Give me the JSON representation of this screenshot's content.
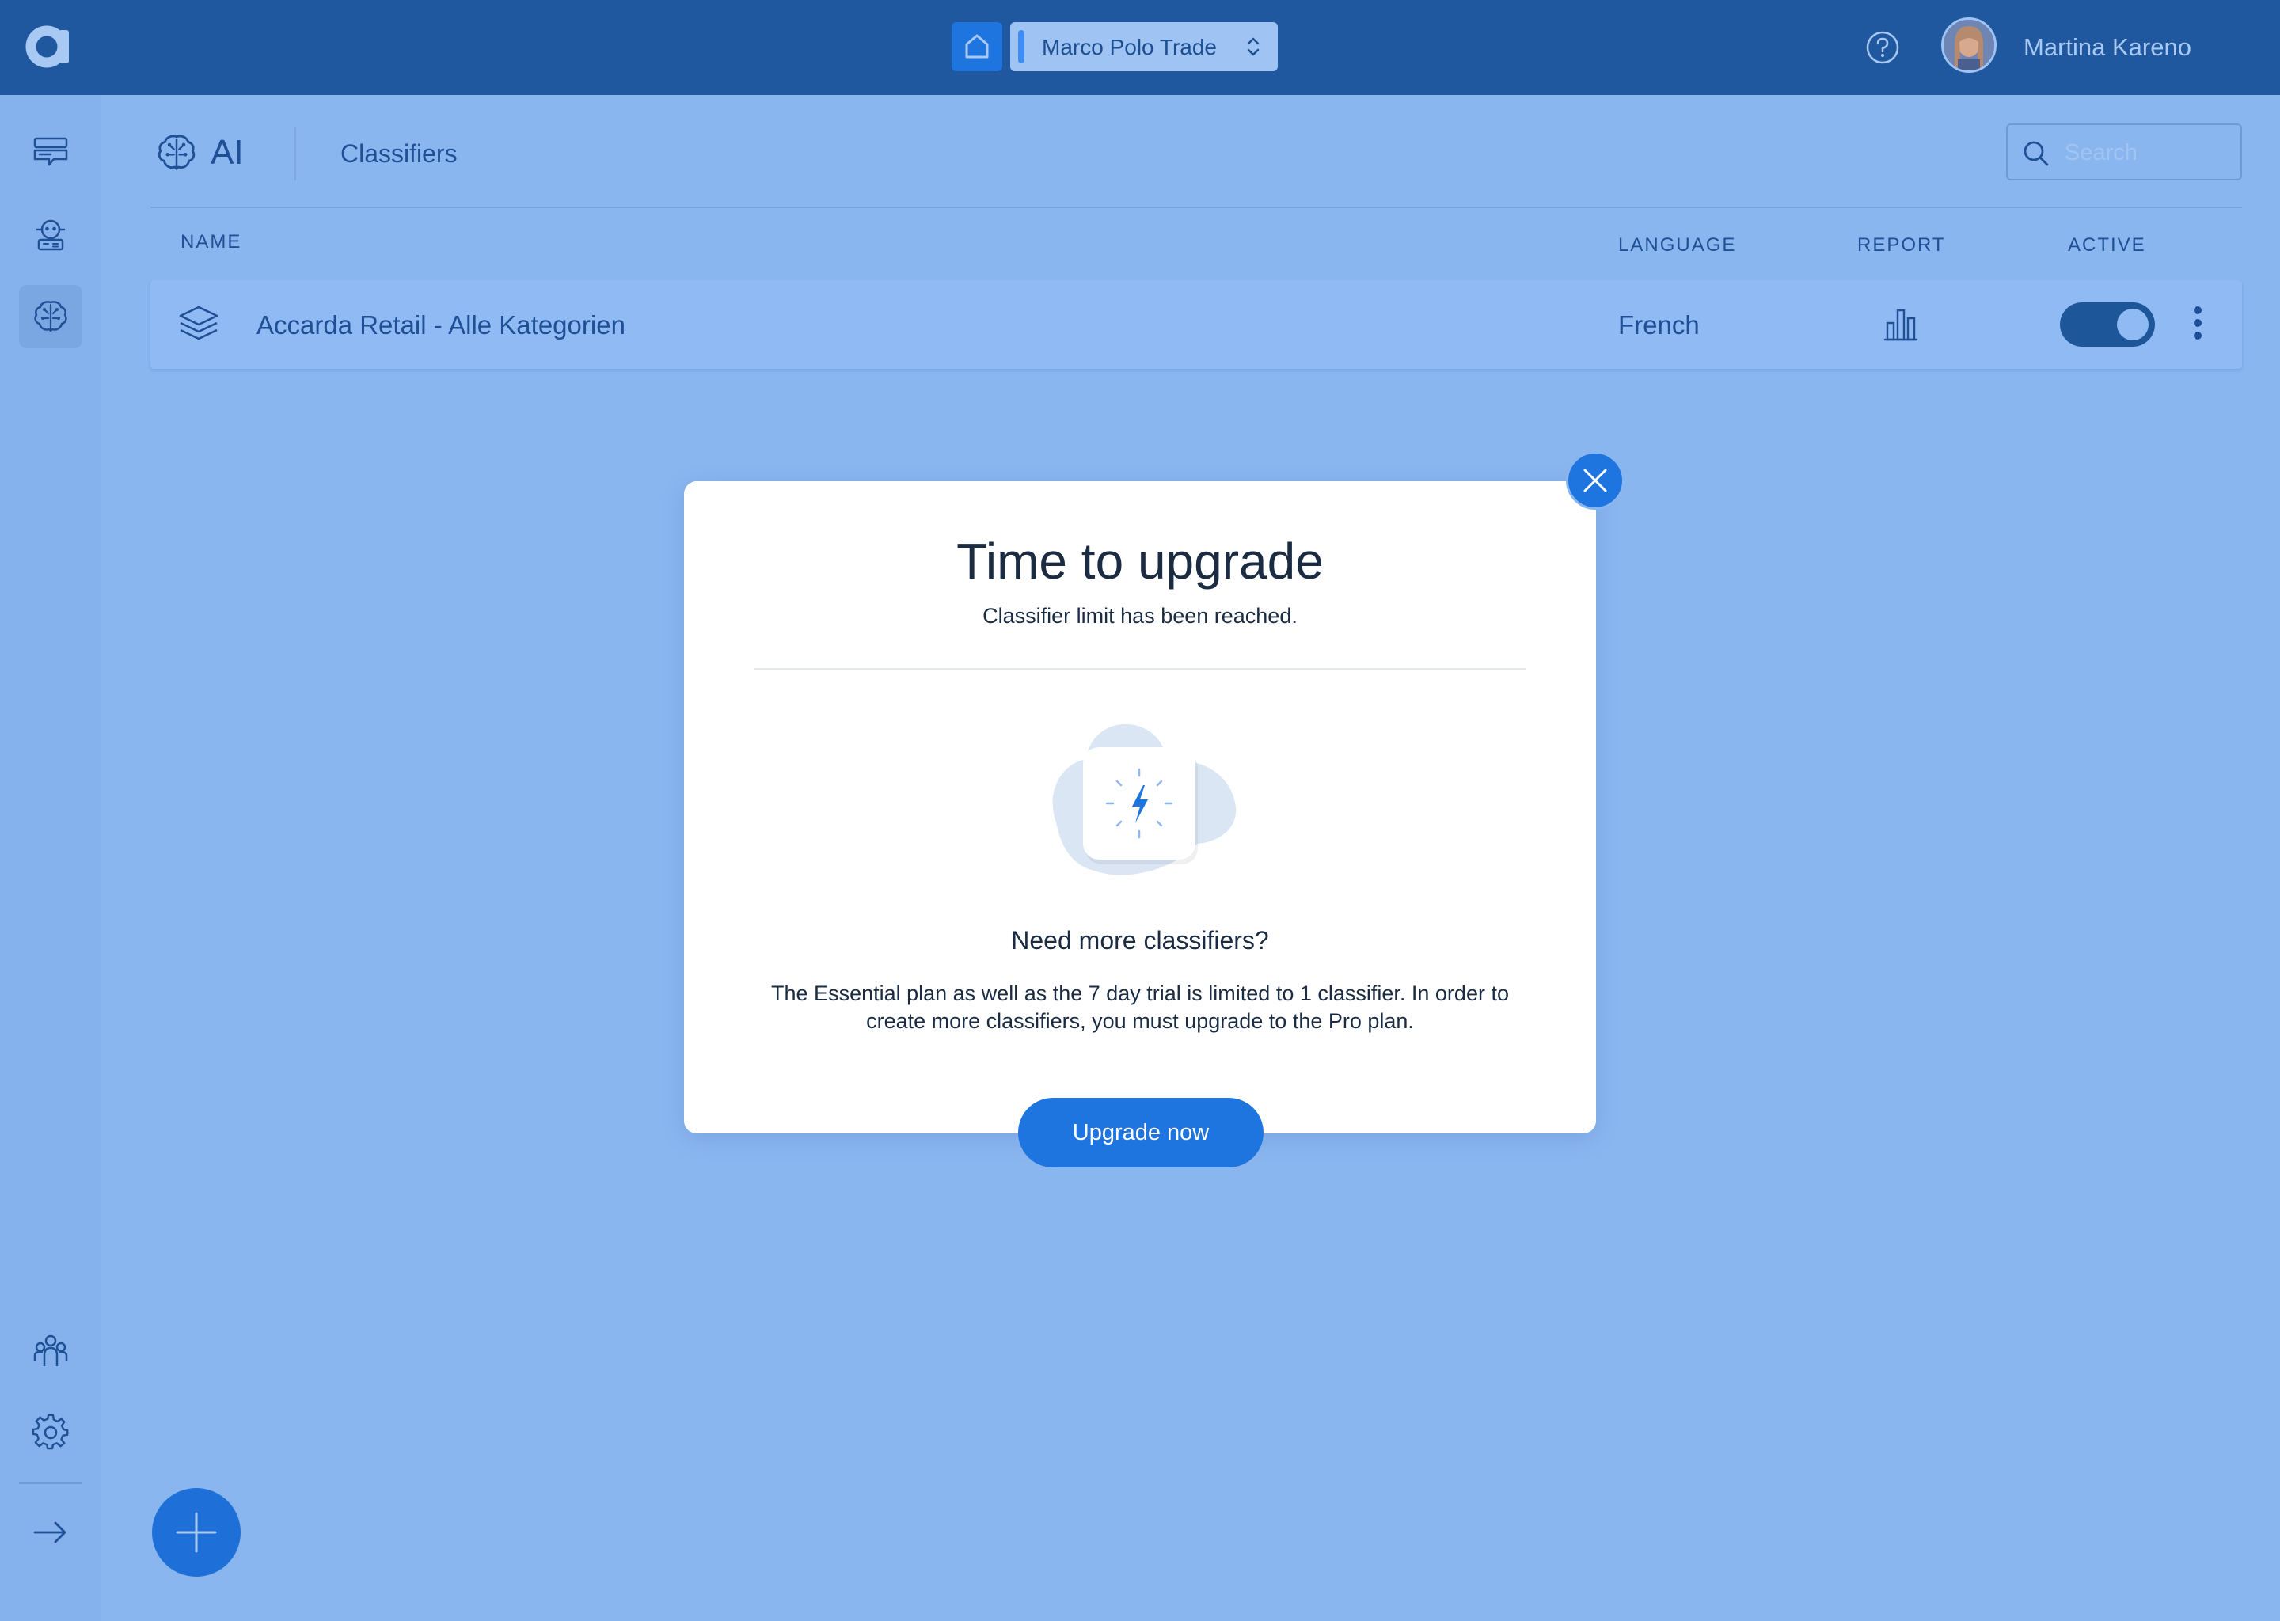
{
  "topbar": {
    "workspace_name": "Marco Polo Trade",
    "user_name": "Martina Kareno",
    "icons": [
      "app-logo-icon",
      "home-icon",
      "chevron-updown-icon",
      "help-icon",
      "avatar"
    ]
  },
  "sidebar": {
    "items": [
      {
        "name": "conversations-icon"
      },
      {
        "name": "bot-icon"
      },
      {
        "name": "ai-brain-icon",
        "active": true
      },
      {
        "name": "team-icon"
      },
      {
        "name": "settings-icon"
      },
      {
        "name": "collapse-arrow-icon"
      }
    ]
  },
  "header": {
    "section_title": "AI",
    "breadcrumb": "Classifiers",
    "search_placeholder": "Search"
  },
  "table": {
    "columns": {
      "name": "NAME",
      "language": "LANGUAGE",
      "report": "REPORT",
      "active": "ACTIVE"
    },
    "rows": [
      {
        "name": "Accarda Retail - Alle Kategorien",
        "language": "French",
        "active": true
      }
    ]
  },
  "modal": {
    "title": "Time to upgrade",
    "subtitle": "Classifier limit has been reached.",
    "question": "Need more classifiers?",
    "body": "The Essential plan as well as the 7 day trial is limited to 1 classifier. In order to create more classifiers, you must upgrade to the Pro plan.",
    "cta": "Upgrade now"
  },
  "colors": {
    "topbar": "#2058a0",
    "background": "#8ab6f0",
    "accent": "#1e75e0",
    "text_dark": "#1a2b42"
  }
}
